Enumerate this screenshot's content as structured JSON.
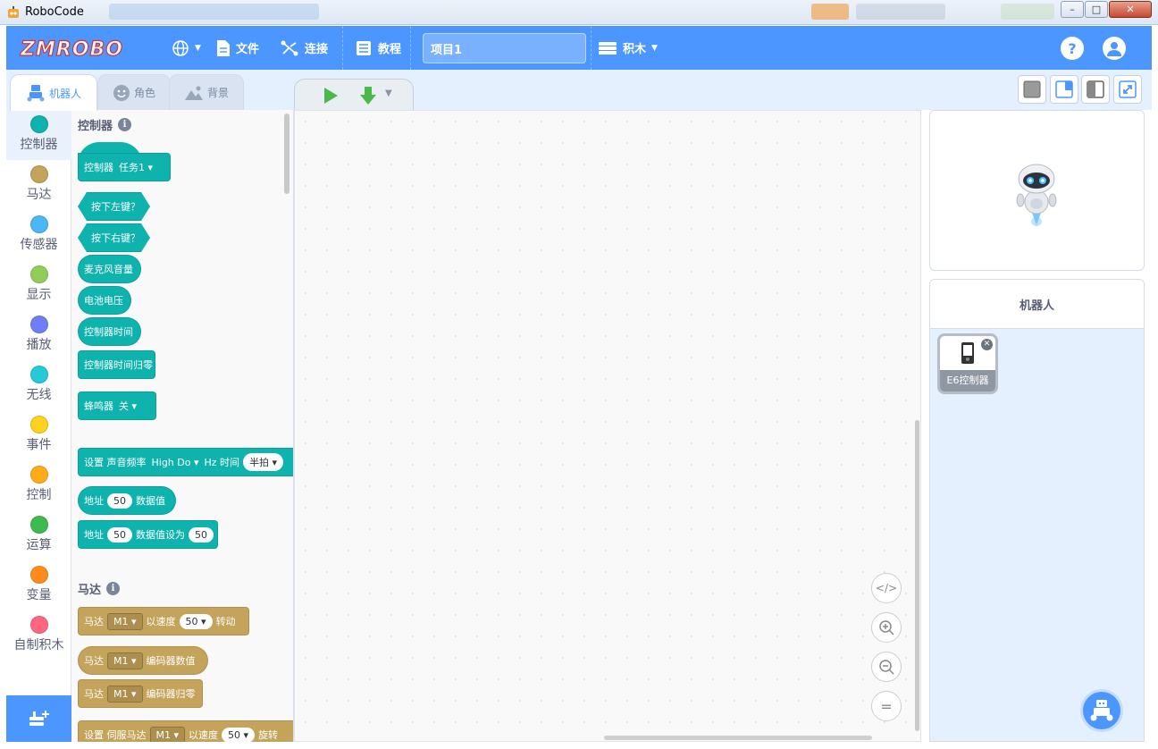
{
  "window": {
    "title": "RoboCode"
  },
  "brand": {
    "logo_text": "ZMROBO",
    "accent": "#4c97ff"
  },
  "topbar": {
    "language_icon": "globe-icon",
    "file_label": "文件",
    "connect_label": "连接",
    "tutorial_label": "教程",
    "project_name": "项目1",
    "mode_label": "积木"
  },
  "tabs": [
    {
      "label": "机器人",
      "icon": "robot-icon",
      "active": true
    },
    {
      "label": "角色",
      "icon": "sprite-icon",
      "active": false
    },
    {
      "label": "背景",
      "icon": "backdrop-icon",
      "active": false
    }
  ],
  "categories": [
    {
      "label": "控制器",
      "color": "#0fb3ad"
    },
    {
      "label": "马达",
      "color": "#c4a35a"
    },
    {
      "label": "传感器",
      "color": "#4cb7f5"
    },
    {
      "label": "显示",
      "color": "#8fce5a"
    },
    {
      "label": "播放",
      "color": "#6f7ef5"
    },
    {
      "label": "无线",
      "color": "#26c9d6"
    },
    {
      "label": "事件",
      "color": "#ffd21e"
    },
    {
      "label": "控制",
      "color": "#ffab1a"
    },
    {
      "label": "运算",
      "color": "#3dbb4e"
    },
    {
      "label": "变量",
      "color": "#ff8c1a"
    },
    {
      "label": "自制积木",
      "color": "#ff6680"
    }
  ],
  "palette": {
    "controller_title": "控制器",
    "motor_title": "马达",
    "blocks": {
      "controller_task": {
        "text": "控制器",
        "task": "任务1"
      },
      "left_key": "按下左键？",
      "right_key": "按下右键？",
      "mic_volume": "麦克风音量",
      "battery_voltage": "电池电压",
      "controller_time": "控制器时间",
      "reset_time": "控制器时间归零",
      "buzzer": {
        "text": "蜂鸣器",
        "value": "关"
      },
      "set_tone": {
        "text": "设置 声音频率",
        "note": "High Do",
        "hz_time": "Hz 时间",
        "beat": "半拍"
      },
      "address_value": {
        "prefix": "地址",
        "addr": "50",
        "suffix": "数据值"
      },
      "address_set": {
        "prefix": "地址",
        "addr": "50",
        "mid": "数据值设为",
        "value": "50"
      },
      "motor_speed": {
        "prefix": "马达",
        "motor": "M1",
        "mid": "以速度",
        "speed": "50",
        "suffix": "转动"
      },
      "motor_encoder": {
        "prefix": "马达",
        "motor": "M1",
        "suffix": "编码器数值"
      },
      "motor_encoder_reset": {
        "prefix": "马达",
        "motor": "M1",
        "suffix": "编码器归零"
      },
      "servo": {
        "prefix": "设置 伺服马达",
        "motor": "M1",
        "mid": "以速度",
        "speed": "50",
        "suffix": "旋转"
      }
    }
  },
  "workspace": {
    "code_icon": "code-icon",
    "zoom_in_icon": "zoom-in-icon",
    "zoom_out_icon": "zoom-out-icon",
    "reset_icon": "equals-icon"
  },
  "side_panel": {
    "title": "机器人",
    "device": {
      "name": "E6控制器",
      "icon": "phone-controller-icon"
    }
  }
}
